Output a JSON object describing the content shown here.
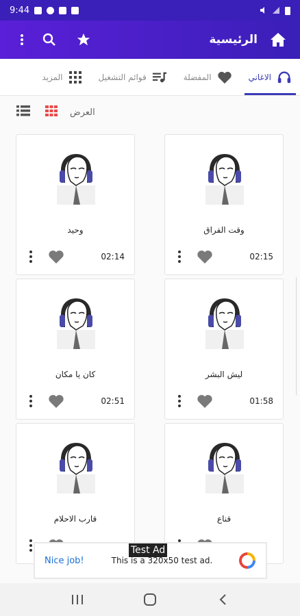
{
  "status_bar": {
    "time": "9:44",
    "left_icons": [
      "shopping-bag-icon",
      "pinterest-icon",
      "image-icon",
      "youtube-icon"
    ],
    "right_icons": [
      "mute-icon",
      "signal-off-icon",
      "battery-icon"
    ]
  },
  "app_bar": {
    "title": "الرئيسية",
    "home_icon": "home-icon",
    "actions": [
      "star-icon",
      "search-icon",
      "overflow-menu-icon"
    ]
  },
  "tabs": [
    {
      "label": "الاغاني",
      "icon": "headphones-icon",
      "active": true
    },
    {
      "label": "المفضلة",
      "icon": "heart-icon",
      "active": false
    },
    {
      "label": "قوائم التشغيل",
      "icon": "playlist-icon",
      "active": false
    },
    {
      "label": "المزيد",
      "icon": "apps-grid-icon",
      "active": false
    }
  ],
  "view": {
    "label": "العرض",
    "grid_icon": "grid-view-icon",
    "list_icon": "list-view-icon"
  },
  "songs": [
    {
      "title": "وقت الفراق",
      "duration": "02:15"
    },
    {
      "title": "وحيد",
      "duration": "02:14"
    },
    {
      "title": "ليش البشر",
      "duration": "01:58"
    },
    {
      "title": "كان يا مكان",
      "duration": "02:51"
    },
    {
      "title": "قناع",
      "duration": ""
    },
    {
      "title": "قارب الاحلام",
      "duration": ""
    }
  ],
  "ad": {
    "tag": "Test Ad",
    "cta": "Nice job!",
    "text": "This is a 320x50 test ad."
  },
  "colors": {
    "accent": "#3a1fb8",
    "tab_active": "#3a3ab8"
  }
}
